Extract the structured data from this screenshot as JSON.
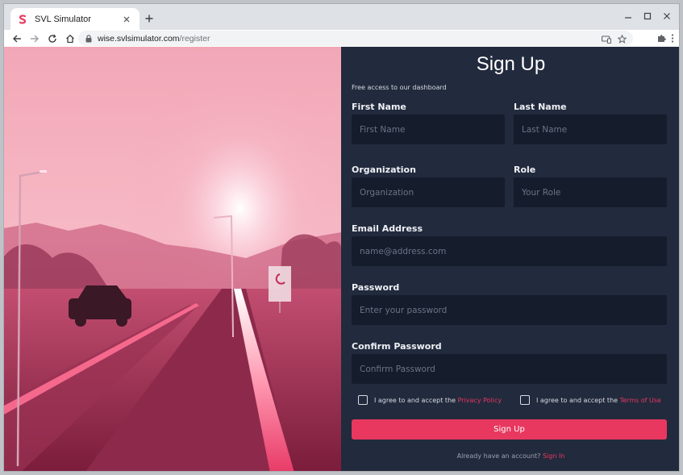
{
  "browser": {
    "tab_title": "SVL Simulator",
    "url_host": "wise.svlsimulator.com",
    "url_path": "/register"
  },
  "form": {
    "title": "Sign Up",
    "subtitle": "Free access to our dashboard",
    "first_name": {
      "label": "First Name",
      "placeholder": "First Name"
    },
    "last_name": {
      "label": "Last Name",
      "placeholder": "Last Name"
    },
    "organization": {
      "label": "Organization",
      "placeholder": "Organization"
    },
    "role": {
      "label": "Role",
      "placeholder": "Your Role"
    },
    "email": {
      "label": "Email Address",
      "placeholder": "name@address.com"
    },
    "password": {
      "label": "Password",
      "placeholder": "Enter your password"
    },
    "confirm_password": {
      "label": "Confirm Password",
      "placeholder": "Confirm Password"
    },
    "privacy": {
      "text": "I agree to and accept the ",
      "link": "Privacy Policy"
    },
    "terms": {
      "text": "I agree to and accept the ",
      "link": "Terms of Use"
    },
    "submit_label": "Sign Up",
    "footer_text": "Already have an account? ",
    "footer_link": "Sign In"
  },
  "colors": {
    "accent": "#e8385f",
    "panel_bg": "#222a3d",
    "field_bg": "#151c2c"
  }
}
